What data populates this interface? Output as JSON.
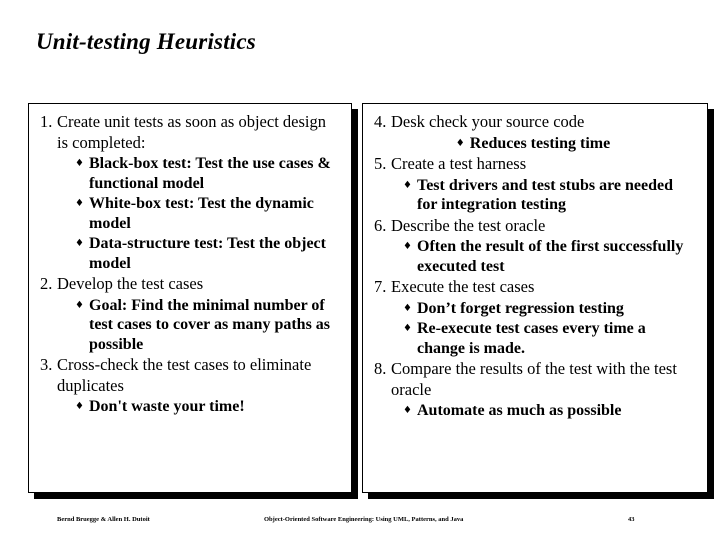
{
  "slide": {
    "title": "Unit-testing Heuristics",
    "bullet_glyph": "♦"
  },
  "left_column": {
    "items": [
      {
        "level": 1,
        "number": "1.",
        "text": "Create unit tests as soon as object design is completed:"
      },
      {
        "level": 2,
        "text": "Black-box test: Test the use cases & functional model"
      },
      {
        "level": 2,
        "text": "White-box test: Test the dynamic model"
      },
      {
        "level": 2,
        "text": "Data-structure test: Test the object model"
      },
      {
        "level": 1,
        "number": "2.",
        "text": "Develop the test cases"
      },
      {
        "level": 2,
        "text": "Goal: Find the minimal number of test cases to cover as many paths as possible"
      },
      {
        "level": 1,
        "number": "3.",
        "text": "Cross-check the test cases to eliminate duplicates"
      },
      {
        "level": 2,
        "text": "Don't waste your time!"
      }
    ]
  },
  "right_column": {
    "items": [
      {
        "level": 1,
        "number": "4.",
        "text": "Desk check your source code"
      },
      {
        "level": 2,
        "centered": true,
        "text": "Reduces testing time"
      },
      {
        "level": 1,
        "number": "5.",
        "text": "Create a test harness"
      },
      {
        "level": 2,
        "text": "Test drivers and test stubs are needed for integration testing"
      },
      {
        "level": 1,
        "number": "6.",
        "text": "Describe the test oracle"
      },
      {
        "level": 2,
        "text": "Often the result of the first successfully executed test"
      },
      {
        "level": 1,
        "number": "7.",
        "text": "Execute the test cases"
      },
      {
        "level": 2,
        "text": "Don’t forget regression testing"
      },
      {
        "level": 2,
        "text": "Re-execute test cases every time a change is made."
      },
      {
        "level": 1,
        "number": "8.",
        "text": "Compare the results of the test with the test oracle"
      },
      {
        "level": 2,
        "text": "Automate as much as possible"
      }
    ]
  },
  "footer": {
    "authors": "Bernd Bruegge & Allen H. Dutoit",
    "book": "Object-Oriented Software Engineering: Using UML, Patterns, and Java",
    "page": "43"
  }
}
